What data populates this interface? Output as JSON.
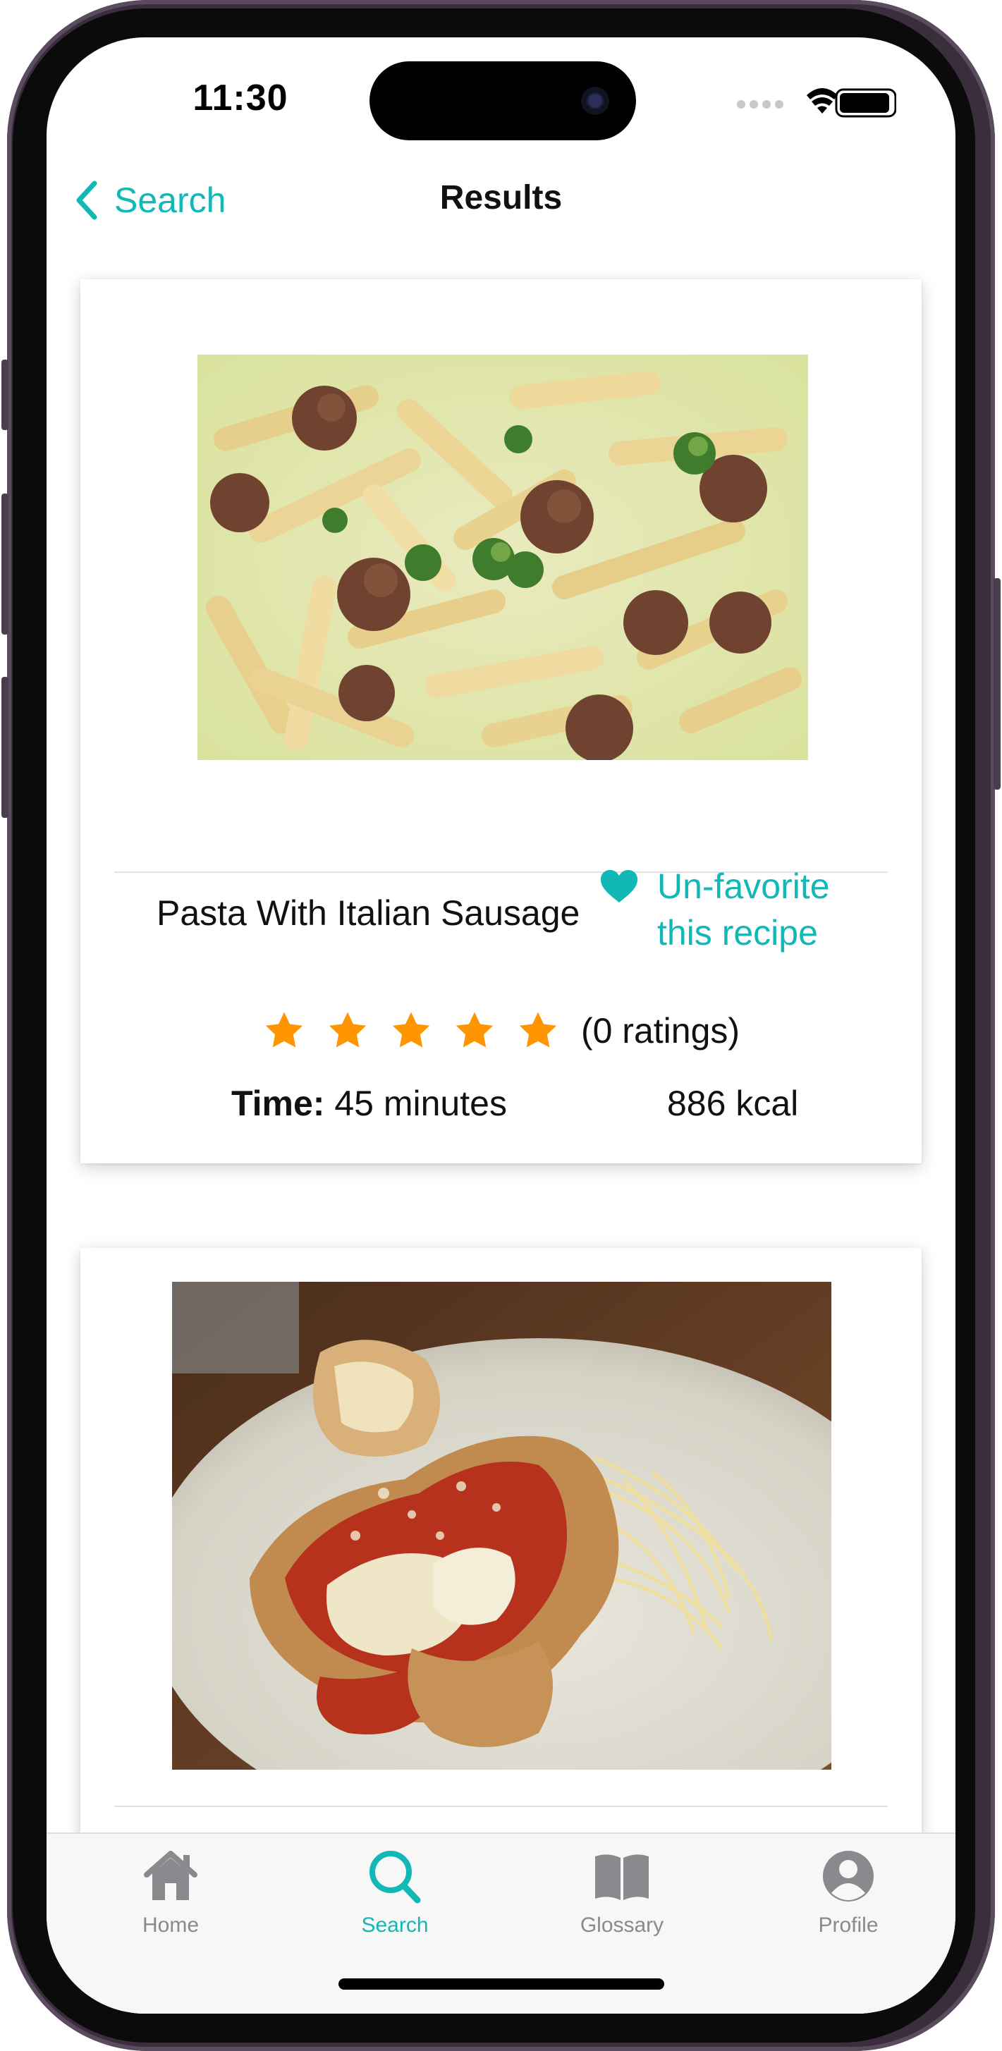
{
  "status_bar": {
    "time": "11:30"
  },
  "nav": {
    "back_label": "Search",
    "title": "Results"
  },
  "results": [
    {
      "title": "Pasta With Italian Sausage",
      "favorite_label": "Un-favorite this recipe",
      "rating_stars": 5,
      "rating_count_label": "(0 ratings)",
      "time_label": "Time:",
      "time_value": "45 minutes",
      "calories": "886 kcal"
    }
  ],
  "tabbar": {
    "items": [
      {
        "label": "Home",
        "icon": "house-icon",
        "active": false
      },
      {
        "label": "Search",
        "icon": "magnifier-icon",
        "active": true
      },
      {
        "label": "Glossary",
        "icon": "book-icon",
        "active": false
      },
      {
        "label": "Profile",
        "icon": "person-circle-icon",
        "active": false
      }
    ]
  },
  "colors": {
    "accent": "#12b8b5",
    "star": "#ff9500",
    "text": "#111111",
    "tab_inactive": "#8a8a8e"
  }
}
